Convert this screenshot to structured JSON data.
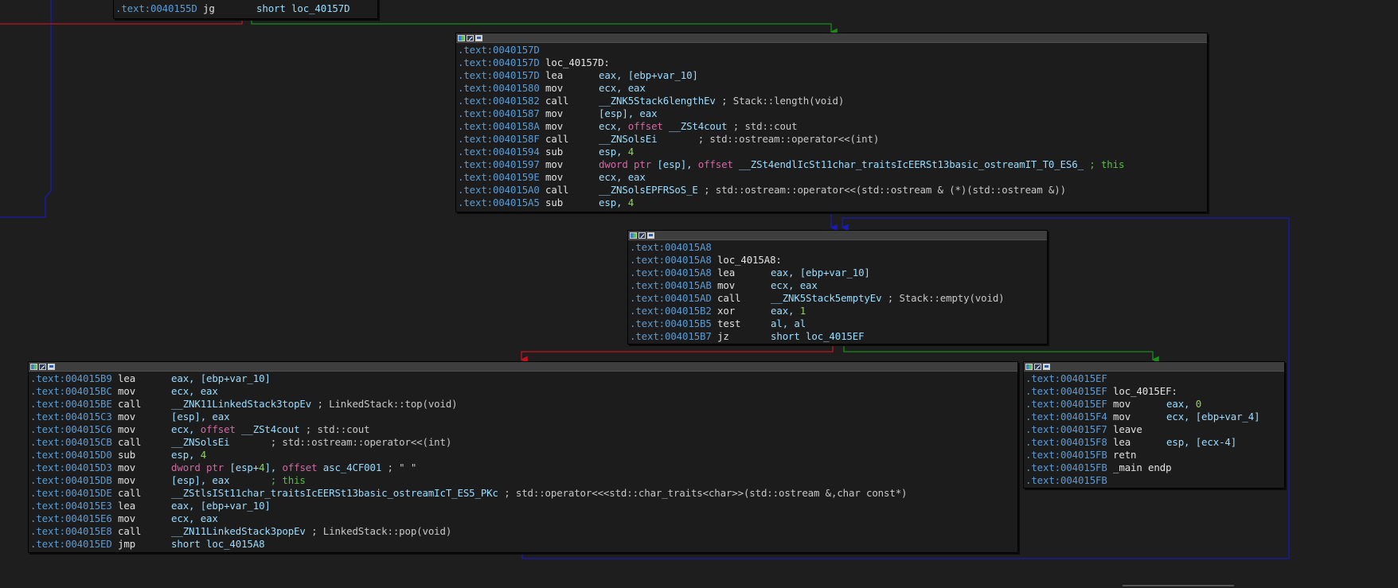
{
  "colors": {
    "background": "#1e1e1e",
    "address": "#5b9bd5",
    "operand": "#9cdcfe",
    "keyword_offset": "#d06aa4",
    "number": "#8fd460",
    "comment_green": "#52c23c",
    "edge_true": "#1a8a1a",
    "edge_false": "#c2141c",
    "edge_back": "#1a1ab4"
  },
  "node_top": {
    "lines": [
      {
        "addr": ".text:0040155D",
        "label": "",
        "mn": "jg",
        "ops": [
          {
            "t": "short loc_40157D",
            "c": "op"
          }
        ]
      }
    ]
  },
  "node_a": {
    "lines": [
      {
        "addr": ".text:0040157D",
        "label": "",
        "mn": "",
        "ops": []
      },
      {
        "addr": ".text:0040157D",
        "label": "loc_40157D:",
        "mn": "",
        "ops": []
      },
      {
        "addr": ".text:0040157D",
        "label": "",
        "mn": "lea",
        "ops": [
          {
            "t": "eax, [ebp+var_10]",
            "c": "op"
          }
        ]
      },
      {
        "addr": ".text:00401580",
        "label": "",
        "mn": "mov",
        "ops": [
          {
            "t": "ecx, eax",
            "c": "op"
          }
        ]
      },
      {
        "addr": ".text:00401582",
        "label": "",
        "mn": "call",
        "ops": [
          {
            "t": "__ZNK5Stack6lengthEv",
            "c": "op"
          },
          {
            "t": " ; Stack::length(void)",
            "c": "cmt"
          }
        ]
      },
      {
        "addr": ".text:00401587",
        "label": "",
        "mn": "mov",
        "ops": [
          {
            "t": "[esp], eax",
            "c": "op"
          }
        ]
      },
      {
        "addr": ".text:0040158A",
        "label": "",
        "mn": "mov",
        "ops": [
          {
            "t": "ecx, ",
            "c": "op"
          },
          {
            "t": "offset",
            "c": "kw"
          },
          {
            "t": " __ZSt4cout",
            "c": "op"
          },
          {
            "t": " ; std::cout",
            "c": "cmt"
          }
        ]
      },
      {
        "addr": ".text:0040158F",
        "label": "",
        "mn": "call",
        "ops": [
          {
            "t": "__ZNSolsEi",
            "c": "op"
          },
          {
            "t": "       ; std::ostream::operator<<(int)",
            "c": "cmt"
          }
        ]
      },
      {
        "addr": ".text:00401594",
        "label": "",
        "mn": "sub",
        "ops": [
          {
            "t": "esp, ",
            "c": "op"
          },
          {
            "t": "4",
            "c": "num"
          }
        ]
      },
      {
        "addr": ".text:00401597",
        "label": "",
        "mn": "mov",
        "ops": [
          {
            "t": "dword ptr",
            "c": "kw"
          },
          {
            "t": " [esp], ",
            "c": "op"
          },
          {
            "t": "offset",
            "c": "kw"
          },
          {
            "t": " __ZSt4endlIcSt11char_traitsIcEERSt13basic_ostreamIT_T0_ES6_",
            "c": "op"
          },
          {
            "t": " ; this",
            "c": "gcmt"
          }
        ]
      },
      {
        "addr": ".text:0040159E",
        "label": "",
        "mn": "mov",
        "ops": [
          {
            "t": "ecx, eax",
            "c": "op"
          }
        ]
      },
      {
        "addr": ".text:004015A0",
        "label": "",
        "mn": "call",
        "ops": [
          {
            "t": "__ZNSolsEPFRSoS_E",
            "c": "op"
          },
          {
            "t": " ; std::ostream::operator<<(std::ostream & (*)(std::ostream &))",
            "c": "cmt"
          }
        ]
      },
      {
        "addr": ".text:004015A5",
        "label": "",
        "mn": "sub",
        "ops": [
          {
            "t": "esp, ",
            "c": "op"
          },
          {
            "t": "4",
            "c": "num"
          }
        ]
      }
    ]
  },
  "node_b": {
    "lines": [
      {
        "addr": ".text:004015A8",
        "label": "",
        "mn": "",
        "ops": []
      },
      {
        "addr": ".text:004015A8",
        "label": "loc_4015A8:",
        "mn": "",
        "ops": []
      },
      {
        "addr": ".text:004015A8",
        "label": "",
        "mn": "lea",
        "ops": [
          {
            "t": "eax, [ebp+var_10]",
            "c": "op"
          }
        ]
      },
      {
        "addr": ".text:004015AB",
        "label": "",
        "mn": "mov",
        "ops": [
          {
            "t": "ecx, eax",
            "c": "op"
          }
        ]
      },
      {
        "addr": ".text:004015AD",
        "label": "",
        "mn": "call",
        "ops": [
          {
            "t": "__ZNK5Stack5emptyEv",
            "c": "op"
          },
          {
            "t": " ; Stack::empty(void)",
            "c": "cmt"
          }
        ]
      },
      {
        "addr": ".text:004015B2",
        "label": "",
        "mn": "xor",
        "ops": [
          {
            "t": "eax, ",
            "c": "op"
          },
          {
            "t": "1",
            "c": "num"
          }
        ]
      },
      {
        "addr": ".text:004015B5",
        "label": "",
        "mn": "test",
        "ops": [
          {
            "t": "al, al",
            "c": "op"
          }
        ]
      },
      {
        "addr": ".text:004015B7",
        "label": "",
        "mn": "jz",
        "ops": [
          {
            "t": "short loc_4015EF",
            "c": "op"
          }
        ]
      }
    ]
  },
  "node_c": {
    "lines": [
      {
        "addr": ".text:004015B9",
        "label": "",
        "mn": "lea",
        "ops": [
          {
            "t": "eax, [ebp+var_10]",
            "c": "op"
          }
        ]
      },
      {
        "addr": ".text:004015BC",
        "label": "",
        "mn": "mov",
        "ops": [
          {
            "t": "ecx, eax",
            "c": "op"
          }
        ]
      },
      {
        "addr": ".text:004015BE",
        "label": "",
        "mn": "call",
        "ops": [
          {
            "t": "__ZNK11LinkedStack3topEv",
            "c": "op"
          },
          {
            "t": " ; LinkedStack::top(void)",
            "c": "cmt"
          }
        ]
      },
      {
        "addr": ".text:004015C3",
        "label": "",
        "mn": "mov",
        "ops": [
          {
            "t": "[esp], eax",
            "c": "op"
          }
        ]
      },
      {
        "addr": ".text:004015C6",
        "label": "",
        "mn": "mov",
        "ops": [
          {
            "t": "ecx, ",
            "c": "op"
          },
          {
            "t": "offset",
            "c": "kw"
          },
          {
            "t": " __ZSt4cout",
            "c": "op"
          },
          {
            "t": " ; std::cout",
            "c": "cmt"
          }
        ]
      },
      {
        "addr": ".text:004015CB",
        "label": "",
        "mn": "call",
        "ops": [
          {
            "t": "__ZNSolsEi",
            "c": "op"
          },
          {
            "t": "       ; std::ostream::operator<<(int)",
            "c": "cmt"
          }
        ]
      },
      {
        "addr": ".text:004015D0",
        "label": "",
        "mn": "sub",
        "ops": [
          {
            "t": "esp, ",
            "c": "op"
          },
          {
            "t": "4",
            "c": "num"
          }
        ]
      },
      {
        "addr": ".text:004015D3",
        "label": "",
        "mn": "mov",
        "ops": [
          {
            "t": "dword ptr",
            "c": "kw"
          },
          {
            "t": " [esp+",
            "c": "op"
          },
          {
            "t": "4",
            "c": "num"
          },
          {
            "t": "], ",
            "c": "op"
          },
          {
            "t": "offset",
            "c": "kw"
          },
          {
            "t": " asc_4CF001",
            "c": "op"
          },
          {
            "t": " ; \" \"",
            "c": "cmt"
          }
        ]
      },
      {
        "addr": ".text:004015DB",
        "label": "",
        "mn": "mov",
        "ops": [
          {
            "t": "[esp], eax",
            "c": "op"
          },
          {
            "t": "       ; this",
            "c": "gcmt"
          }
        ]
      },
      {
        "addr": ".text:004015DE",
        "label": "",
        "mn": "call",
        "ops": [
          {
            "t": "__ZStlsISt11char_traitsIcEERSt13basic_ostreamIcT_ES5_PKc",
            "c": "op"
          },
          {
            "t": " ; std::operator<<<std::char_traits<char>>(std::ostream &,char const*)",
            "c": "cmt"
          }
        ]
      },
      {
        "addr": ".text:004015E3",
        "label": "",
        "mn": "lea",
        "ops": [
          {
            "t": "eax, [ebp+var_10]",
            "c": "op"
          }
        ]
      },
      {
        "addr": ".text:004015E6",
        "label": "",
        "mn": "mov",
        "ops": [
          {
            "t": "ecx, eax",
            "c": "op"
          }
        ]
      },
      {
        "addr": ".text:004015E8",
        "label": "",
        "mn": "call",
        "ops": [
          {
            "t": "__ZN11LinkedStack3popEv",
            "c": "op"
          },
          {
            "t": " ; LinkedStack::pop(void)",
            "c": "cmt"
          }
        ]
      },
      {
        "addr": ".text:004015ED",
        "label": "",
        "mn": "jmp",
        "ops": [
          {
            "t": "short loc_4015A8",
            "c": "op"
          }
        ]
      }
    ]
  },
  "node_d": {
    "lines": [
      {
        "addr": ".text:004015EF",
        "label": "",
        "mn": "",
        "ops": []
      },
      {
        "addr": ".text:004015EF",
        "label": "loc_4015EF:",
        "mn": "",
        "ops": []
      },
      {
        "addr": ".text:004015EF",
        "label": "",
        "mn": "mov",
        "ops": [
          {
            "t": "eax, ",
            "c": "op"
          },
          {
            "t": "0",
            "c": "num"
          }
        ]
      },
      {
        "addr": ".text:004015F4",
        "label": "",
        "mn": "mov",
        "ops": [
          {
            "t": "ecx, [ebp+var_4]",
            "c": "op"
          }
        ]
      },
      {
        "addr": ".text:004015F7",
        "label": "",
        "mn": "leave",
        "ops": []
      },
      {
        "addr": ".text:004015F8",
        "label": "",
        "mn": "lea",
        "ops": [
          {
            "t": "esp, [ecx-4]",
            "c": "op"
          }
        ]
      },
      {
        "addr": ".text:004015FB",
        "label": "",
        "mn": "retn",
        "ops": []
      },
      {
        "addr": ".text:004015FB",
        "label": "_main endp",
        "mn": "",
        "ops": []
      },
      {
        "addr": ".text:004015FB",
        "label": "",
        "mn": "",
        "ops": []
      }
    ]
  }
}
